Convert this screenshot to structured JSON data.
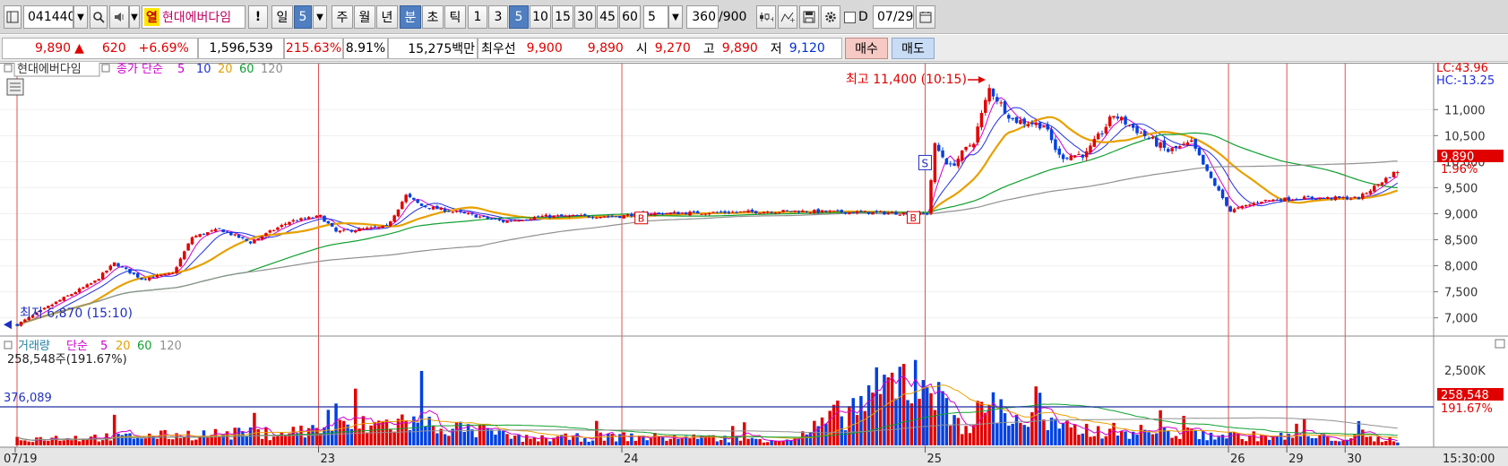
{
  "toolbar": {
    "stock_code": "041440",
    "warn_badge": "열",
    "stock_name": "현대에버다임",
    "alert_label": "!",
    "period_day": "일",
    "period_day_value": "5",
    "period_week": "주",
    "period_month": "월",
    "period_year": "년",
    "period_minute": "분",
    "period_second": "초",
    "period_tick": "틱",
    "intervals": [
      "1",
      "3",
      "5",
      "10",
      "15",
      "30",
      "45",
      "60"
    ],
    "interval_select_value": "5",
    "count_value": "360",
    "count_total": "/900",
    "date_checkbox_label": "D",
    "date_value": "07/29"
  },
  "quote": {
    "price": "9,890",
    "change_arrow": "▲",
    "change": "620",
    "change_pct": "+6.69%",
    "volume": "1,596,539",
    "volume_ratio": "215.63%",
    "turnover": "8.91%",
    "amount": "15,275백만",
    "best_quote_label": "최우선",
    "best_ask": "9,900",
    "best_bid": "9,890",
    "open_label": "시",
    "open": "9,270",
    "high_label": "고",
    "high": "9,890",
    "low_label": "저",
    "low": "9,120",
    "buy_button": "매수",
    "sell_button": "매도"
  },
  "price_panel": {
    "title": "현대에버다임",
    "ma_label": "종가 단순",
    "ma_periods": [
      "5",
      "10",
      "20",
      "60",
      "120"
    ],
    "high_marker": "최고 11,400 (10:15)",
    "low_marker": "최저 6,870 (15:10)",
    "signal_s": "S",
    "signal_b": "B",
    "lc": "LC:43.96",
    "hc": "HC:-13.25",
    "current_price_tag": "9,890",
    "current_pct_tag": "1.96%"
  },
  "volume_panel": {
    "title": "거래량",
    "ma_label": "단순",
    "ma_periods": [
      "5",
      "20",
      "60",
      "120"
    ],
    "readout": "258,548주(191.67%)",
    "ref_value": "376,089",
    "axis_label": "2,500K",
    "current_tag": "258,548",
    "current_pct_tag": "191.67%"
  },
  "x_axis": {
    "dates": [
      {
        "label": "07/19",
        "index": 0
      },
      {
        "label": "23",
        "index": 78
      },
      {
        "label": "24",
        "index": 156
      },
      {
        "label": "25",
        "index": 234
      },
      {
        "label": "26",
        "index": 312
      },
      {
        "label": "29",
        "index": 327
      },
      {
        "label": "30",
        "index": 342
      }
    ],
    "time_label": "15:30:00"
  },
  "colors": {
    "up": "#e00000",
    "down": "#0040e0",
    "ma5": "#d000d0",
    "ma10": "#2030e0",
    "ma20": "#e8a000",
    "ma60": "#10a030",
    "ma120": "#909090",
    "session_line": "#e05050"
  },
  "chart_data": {
    "type": "candlestick",
    "bars": 356,
    "y_ticks": [
      7000,
      7500,
      8000,
      8500,
      9000,
      9500,
      10000,
      10500,
      11000
    ],
    "y_range": [
      6650,
      11900
    ],
    "price_anchors": [
      [
        0,
        6870
      ],
      [
        10,
        7300
      ],
      [
        20,
        7700
      ],
      [
        25,
        8050
      ],
      [
        32,
        7750
      ],
      [
        40,
        7850
      ],
      [
        45,
        8550
      ],
      [
        52,
        8700
      ],
      [
        60,
        8450
      ],
      [
        70,
        8850
      ],
      [
        78,
        8950
      ],
      [
        82,
        8650
      ],
      [
        95,
        8750
      ],
      [
        100,
        9350
      ],
      [
        104,
        9150
      ],
      [
        115,
        9000
      ],
      [
        125,
        8850
      ],
      [
        135,
        8950
      ],
      [
        155,
        8950
      ],
      [
        160,
        9000
      ],
      [
        200,
        9050
      ],
      [
        234,
        9000
      ],
      [
        236,
        10300
      ],
      [
        240,
        9900
      ],
      [
        246,
        10400
      ],
      [
        250,
        11400
      ],
      [
        256,
        10800
      ],
      [
        264,
        10700
      ],
      [
        268,
        10100
      ],
      [
        275,
        10150
      ],
      [
        282,
        10900
      ],
      [
        290,
        10500
      ],
      [
        296,
        10200
      ],
      [
        302,
        10350
      ],
      [
        306,
        9800
      ],
      [
        312,
        9050
      ],
      [
        320,
        9250
      ],
      [
        330,
        9300
      ],
      [
        345,
        9300
      ],
      [
        356,
        9890
      ]
    ],
    "volume_anchors": [
      [
        0,
        300
      ],
      [
        30,
        380
      ],
      [
        45,
        480
      ],
      [
        65,
        520
      ],
      [
        78,
        700
      ],
      [
        101,
        1050
      ],
      [
        130,
        300
      ],
      [
        156,
        380
      ],
      [
        200,
        260
      ],
      [
        234,
        3400
      ],
      [
        238,
        1600
      ],
      [
        245,
        900
      ],
      [
        250,
        1900
      ],
      [
        256,
        1200
      ],
      [
        270,
        700
      ],
      [
        290,
        600
      ],
      [
        312,
        420
      ],
      [
        330,
        360
      ],
      [
        356,
        258
      ]
    ]
  }
}
